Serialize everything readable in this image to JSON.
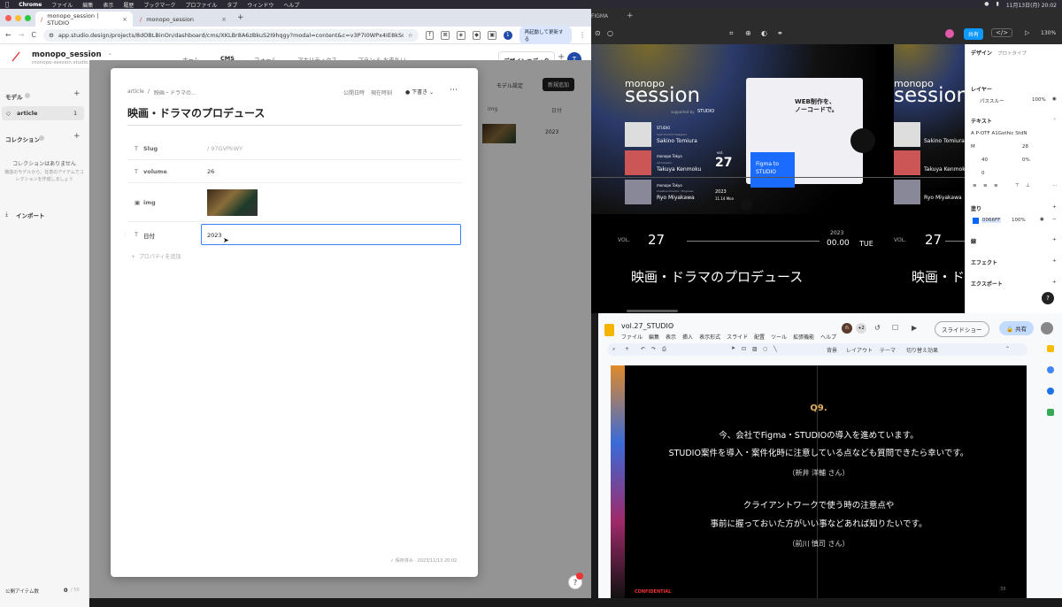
{
  "menubar": {
    "app": "Chrome",
    "items": [
      "ファイル",
      "編集",
      "表示",
      "履歴",
      "ブックマーク",
      "プロファイル",
      "タブ",
      "ウィンドウ",
      "ヘルプ"
    ],
    "clock": "11月13日(月) 20:02"
  },
  "chrome": {
    "tabs": [
      {
        "title": "monopo_session | STUDIO"
      },
      {
        "title": "monopo_session"
      }
    ],
    "url": "app.studio.design/projects/8dOBLBinOn/dashboard/cms/XKLBr8A6zBkuS2I9hqgy?modal=content&c=v3P7I0WPx4IE8kSoz...",
    "relaunch_label": "再起動して更新する",
    "new_tab": "+"
  },
  "studio": {
    "project_name": "monopo_session",
    "project_domain": "monopo-session.studio.site",
    "nav": [
      "ホーム",
      "CMS",
      "フォーム",
      "アナリティクス",
      "プラン & お支払い"
    ],
    "design_editor": "デザインエディタ",
    "avatar": "T",
    "sidebar": {
      "model_label": "モデル",
      "article_label": "article",
      "article_count": "1",
      "collection_label": "コレクション",
      "empty_title": "コレクションはありません",
      "empty_desc": "機能のモデルから、任意のアイテムでコレクションを作成しましょう",
      "import_label": "インポート",
      "publish_label": "公開アイテム数",
      "publish_count": "0",
      "publish_total": "/ 50"
    },
    "list": {
      "model_settings": "モデル設定",
      "new_add": "新規追加",
      "col_img": "img",
      "col_date": "日付",
      "row_date": "2023"
    }
  },
  "modal": {
    "breadcrumb_root": "article",
    "breadcrumb_current": "映画・ドラマの...",
    "publish_date": "公開日時",
    "now": "現在時刻",
    "draft": "下書き",
    "title": "映画・ドラマのプロデュース",
    "props": [
      {
        "label": "Slug",
        "value": "/ 97GVPkWY"
      },
      {
        "label": "volume",
        "value": "26"
      },
      {
        "label": "img",
        "value": ""
      },
      {
        "label": "日付",
        "value": "2023"
      }
    ],
    "add_property": "プロパティを追加",
    "saved": "保存済み · 2023/11/13 20:02"
  },
  "figma": {
    "share": "共有",
    "zoom": "130%",
    "tabs": [
      "デザイン",
      "プロトタイプ"
    ],
    "layer_label": "レイヤー",
    "layer_value": "パススルー",
    "layer_opacity": "100%",
    "text_label": "テキスト",
    "font_name": "A P-OTF A1Gothic StdN",
    "font_weight": "M",
    "font_size": "28",
    "line_height": "40",
    "letter_spacing": "0%",
    "para": "0",
    "fill_label": "塗り",
    "fill_hex": "0066FF",
    "fill_opacity": "100%",
    "stroke_label": "線",
    "effect_label": "エフェクト",
    "export_label": "エクスポート",
    "slide": {
      "logo": "monopo",
      "session": "session",
      "supported_by": "supported by",
      "studio": "STUDIO",
      "speakers": [
        {
          "company": "STUDIO",
          "role": "Lead Product Designer",
          "name": "Sakino Tomiura"
        },
        {
          "company": "monopo Tokyo",
          "role": "Art Director",
          "name": "Takuya Kenmoku"
        },
        {
          "company": "monopo Tokyo",
          "role": "Creative Director / Engineer",
          "name": "Ryo Miyakawa"
        }
      ],
      "vol_label": "vol.",
      "vol_num": "27",
      "year": "2023",
      "date_detail": "11.14 Mon",
      "promo1": "WEB制作を、",
      "promo2": "ノーコードで。",
      "promo_figma": "Figma to",
      "promo_studio": "STUDIO",
      "band_vol": "VOL.",
      "band_num": "27",
      "band_year": "2023",
      "band_time": "00.00",
      "band_day": "TUE",
      "title": "映画・ドラマのプロデュース"
    }
  },
  "slides": {
    "doc_title": "vol.27_STUDIO",
    "menu": [
      "ファイル",
      "編集",
      "表示",
      "挿入",
      "表示形式",
      "スライド",
      "配置",
      "ツール",
      "拡張機能",
      "ヘルプ"
    ],
    "slideshow": "スライドショー",
    "share": "共有",
    "toolbar": [
      "背景",
      "レイアウト",
      "テーマ",
      "切り替え効果"
    ],
    "q_num": "Q9.",
    "q_line1": "今、会社でFigma・STUDIOの導入を進めています。",
    "q_line2": "STUDIO案件を導入・案件化時に注意している点なども質問できたら幸いです。",
    "q_author1": "（新井 洋輔 さん）",
    "q_line3": "クライアントワークで使う時の注意点や",
    "q_line4": "事前に握っておいた方がいい事などあれば知りたいです。",
    "q_author2": "（前川 慎司 さん）",
    "confidential": "CONFIDENTIAL",
    "page": "33",
    "participants": "+2"
  },
  "colors": {
    "accent": "#0066ff",
    "studio_blue": "#1f4aa8"
  }
}
